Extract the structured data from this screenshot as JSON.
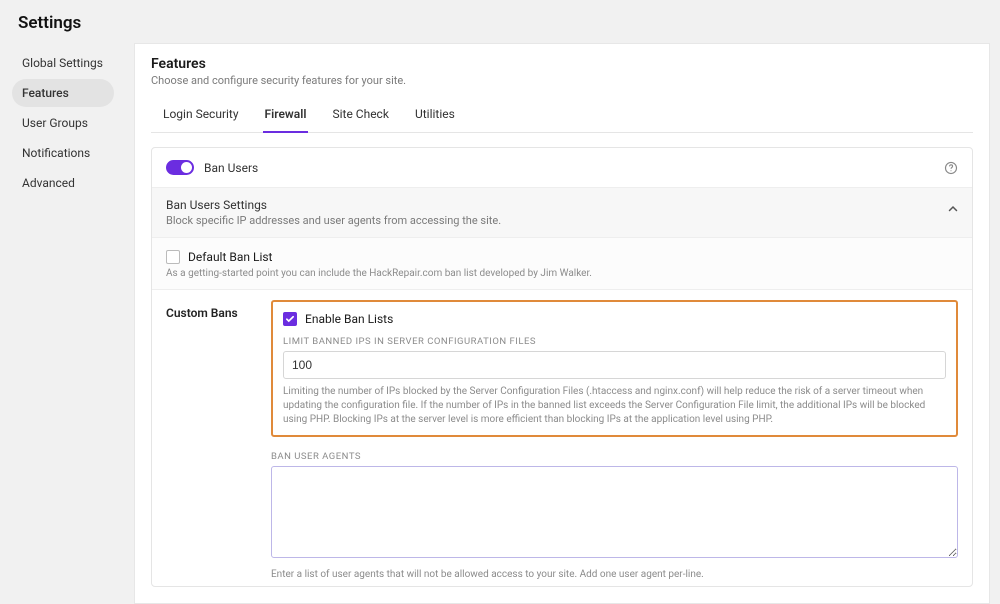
{
  "page_title": "Settings",
  "sidebar": {
    "items": [
      {
        "label": "Global Settings"
      },
      {
        "label": "Features"
      },
      {
        "label": "User Groups"
      },
      {
        "label": "Notifications"
      },
      {
        "label": "Advanced"
      }
    ],
    "active_index": 1
  },
  "features": {
    "title": "Features",
    "subtitle": "Choose and configure security features for your site.",
    "tabs": [
      {
        "label": "Login Security"
      },
      {
        "label": "Firewall"
      },
      {
        "label": "Site Check"
      },
      {
        "label": "Utilities"
      }
    ],
    "active_tab": 1
  },
  "ban_users": {
    "toggle_label": "Ban Users",
    "settings_title": "Ban Users Settings",
    "settings_desc": "Block specific IP addresses and user agents from accessing the site.",
    "default_ban_label": "Default Ban List",
    "default_ban_help": "As a getting-started point you can include the HackRepair.com ban list developed by Jim Walker."
  },
  "custom_bans": {
    "section_title": "Custom Bans",
    "enable_label": "Enable Ban Lists",
    "limit_label": "LIMIT BANNED IPS IN SERVER CONFIGURATION FILES",
    "limit_value": "100",
    "limit_help": "Limiting the number of IPs blocked by the Server Configuration Files (.htaccess and nginx.conf) will help reduce the risk of a server timeout when updating the configuration file. If the number of IPs in the banned list exceeds the Server Configuration File limit, the additional IPs will be blocked using PHP. Blocking IPs at the server level is more efficient than blocking IPs at the application level using PHP.",
    "ban_ua_label": "BAN USER AGENTS",
    "ban_ua_value": "",
    "ban_ua_help": "Enter a list of user agents that will not be allowed access to your site. Add one user agent per-line."
  }
}
